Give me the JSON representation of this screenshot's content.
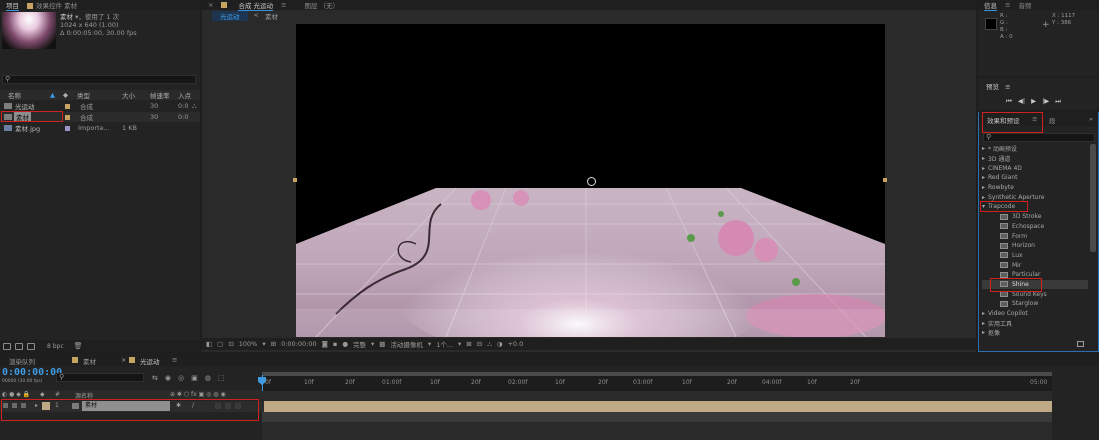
{
  "project": {
    "tab_label": "项目",
    "tab_effect_controls": "效果控件 素材",
    "footage_name": "素材",
    "footage_used": "，使用了 1 次",
    "footage_dims": "1024 x 640 (1.00)",
    "footage_duration": "Δ 0:00:05:00, 30.00 fps",
    "columns": [
      "名称",
      "类型",
      "大小",
      "帧速率",
      "入点"
    ],
    "items": [
      {
        "name": "光运动",
        "type": "合成",
        "rate": "30",
        "in": "0:0"
      },
      {
        "name": "素材",
        "type": "合成",
        "rate": "30",
        "in": "0:0"
      },
      {
        "name": "素材.jpg",
        "type": "Importe...",
        "size": "1 KB",
        "rate": "",
        "in": ""
      }
    ],
    "bpc": "8 bpc"
  },
  "composition": {
    "tab_label": "合成 光运动",
    "sub_tabs": [
      "光运动",
      "素材"
    ],
    "layer_panel": "图层 （无）",
    "zoom": "100%",
    "time": "0:00:00:00",
    "quality": "完整",
    "camera": "活动摄像机",
    "views": "1个...",
    "exposure": "+0.0"
  },
  "info": {
    "tab_label": "信息",
    "tab_audio": "音频",
    "r": "R :",
    "g": "G :",
    "b": "B :",
    "a": "A : 0",
    "x": "X : 1117",
    "y": "Y : 386"
  },
  "preview": {
    "tab_label": "预览"
  },
  "effects": {
    "tab_label": "效果和预设",
    "tab_other": "段",
    "categories_before": [
      "* 动画预设",
      "3D 通道",
      "CINEMA 4D",
      "Red Giant",
      "Rowbyte",
      "Synthetic Aperture"
    ],
    "open_category": "Trapcode",
    "plugins": [
      "3D Stroke",
      "Echospace",
      "Form",
      "Horizon",
      "Lux",
      "Mir",
      "Particular",
      "Shine",
      "Sound Keys",
      "Starglow"
    ],
    "categories_after": [
      "Video Copilot",
      "实用工具",
      "抠像"
    ]
  },
  "timeline": {
    "tabs": [
      "渲染队列",
      "素材",
      "光运动"
    ],
    "timecode": "0:00:00:00",
    "timecode_sub": "00000 (30.00 fps)",
    "layer_header": "源名称",
    "layer_num": "1",
    "layer_name": "素材",
    "ruler_labels": [
      "0f",
      "10f",
      "20f",
      "01:00f",
      "10f",
      "20f",
      "02:00f",
      "10f",
      "20f",
      "03:00f",
      "10f",
      "20f",
      "04:00f",
      "10f",
      "20f",
      "05:00"
    ]
  },
  "colors": {
    "accent_blue": "#3f9ae2",
    "highlight_red": "#d02020",
    "label_tan": "#c8a462",
    "track_bar": "#bfaa85"
  }
}
